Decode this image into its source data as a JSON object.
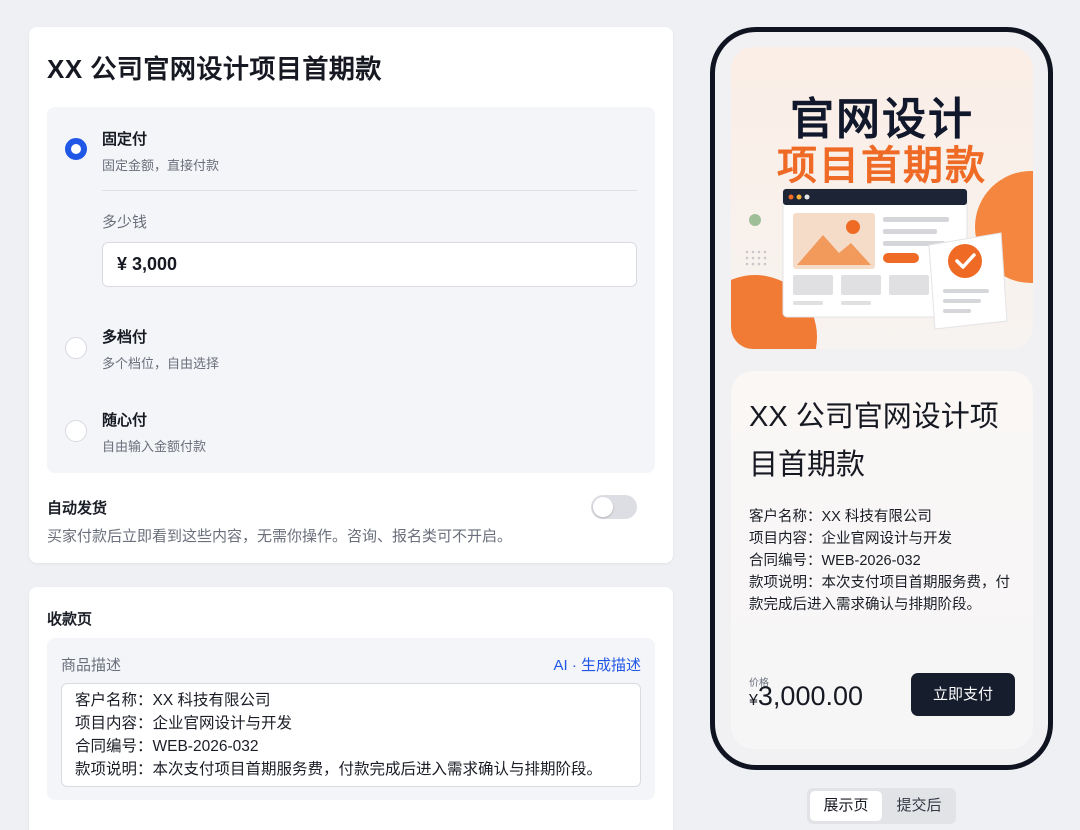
{
  "main_card": {
    "title": "XX 公司官网设计项目首期款",
    "options": [
      {
        "title": "固定付",
        "desc": "固定金额，直接付款",
        "selected": true
      },
      {
        "title": "多档付",
        "desc": "多个档位，自由选择",
        "selected": false
      },
      {
        "title": "随心付",
        "desc": "自由输入金额付款",
        "selected": false
      }
    ],
    "amount_label": "多少钱",
    "amount_value": "¥ 3,000",
    "auto_delivery": {
      "title": "自动发货",
      "desc": "买家付款后立即看到这些内容，无需你操作。咨询、报名类可不开启。",
      "enabled": false
    }
  },
  "payment_page": {
    "title": "收款页",
    "desc_label": "商品描述",
    "ai_link": "AI · 生成描述",
    "desc_lines": [
      "客户名称：XX 科技有限公司",
      "项目内容：企业官网设计与开发",
      "合同编号：WEB-2026-032",
      "款项说明：本次支付项目首期服务费，付款完成后进入需求确认与排期阶段。"
    ]
  },
  "preview": {
    "hero_line1": "官网设计",
    "hero_line2": "项目首期款",
    "title": "XX 公司官网设计项目首期款",
    "lines": [
      "客户名称：XX 科技有限公司",
      "项目内容：企业官网设计与开发",
      "合同编号：WEB-2026-032",
      "款项说明：本次支付项目首期服务费，付款完成后进入需求确认与排期阶段。"
    ],
    "price_caption": "价格",
    "price_symbol": "¥",
    "price_value": "3,000.00",
    "pay_button": "立即支付"
  },
  "tabs": [
    "展示页",
    "提交后"
  ],
  "colors": {
    "accent": "#2157e6",
    "hero_orange": "#ef6a25",
    "dark": "#161d2c"
  }
}
